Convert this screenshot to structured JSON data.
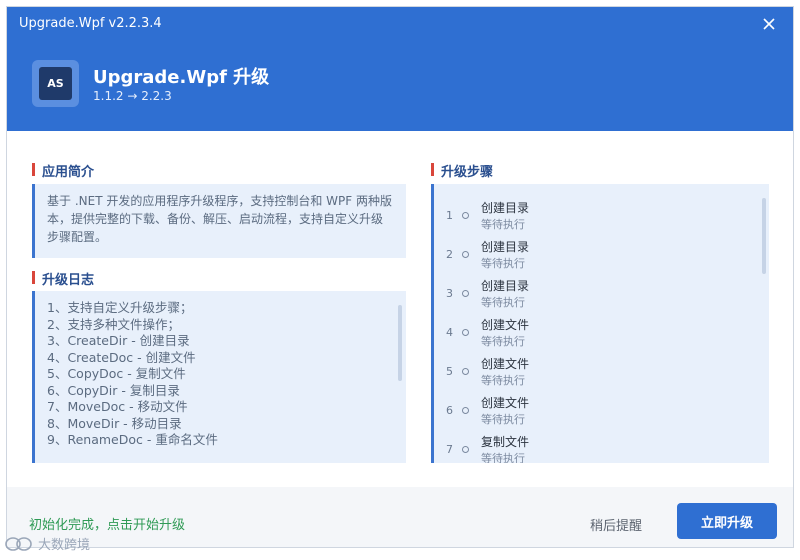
{
  "window": {
    "title": "Upgrade.Wpf v2.2.3.4"
  },
  "header": {
    "logo_text": "AS",
    "app_name": "Upgrade.Wpf 升级",
    "version_line": "1.1.2 → 2.2.3"
  },
  "intro": {
    "title": "应用简介",
    "text": "基于 .NET 开发的应用程序升级程序，支持控制台和 WPF 两种版本，提供完整的下载、备份、解压、启动流程，支持自定义升级步骤配置。"
  },
  "log": {
    "title": "升级日志",
    "lines": [
      "1、支持自定义升级步骤；",
      "2、支持多种文件操作；",
      "3、CreateDir - 创建目录",
      "4、CreateDoc - 创建文件",
      "5、CopyDoc - 复制文件",
      "6、CopyDir - 复制目录",
      "7、MoveDoc - 移动文件",
      "8、MoveDir - 移动目录",
      "9、RenameDoc - 重命名文件"
    ]
  },
  "steps": {
    "title": "升级步骤",
    "items": [
      {
        "num": "1",
        "name": "创建目录",
        "status": "等待执行"
      },
      {
        "num": "2",
        "name": "创建目录",
        "status": "等待执行"
      },
      {
        "num": "3",
        "name": "创建目录",
        "status": "等待执行"
      },
      {
        "num": "4",
        "name": "创建文件",
        "status": "等待执行"
      },
      {
        "num": "5",
        "name": "创建文件",
        "status": "等待执行"
      },
      {
        "num": "6",
        "name": "创建文件",
        "status": "等待执行"
      },
      {
        "num": "7",
        "name": "复制文件",
        "status": "等待执行"
      }
    ]
  },
  "footer": {
    "status": "初始化完成，点击开始升级",
    "later_label": "稍后提醒",
    "upgrade_label": "立即升级"
  },
  "watermark": {
    "text": "大数跨境"
  },
  "icons": {
    "close": "close-icon",
    "watermark": "watermark-logo-icon"
  },
  "colors": {
    "accent": "#2f6fd2",
    "section_marker": "#d9463b",
    "status_ok": "#2f9a55"
  }
}
